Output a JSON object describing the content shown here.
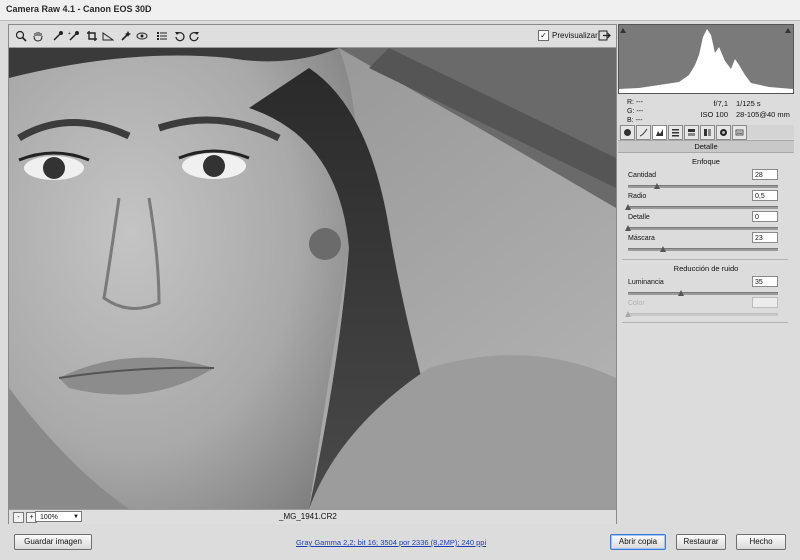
{
  "window": {
    "title": "Camera Raw 4.1 -  Canon EOS 30D"
  },
  "toolbar": {
    "tools": [
      "zoom-icon",
      "hand-icon",
      "white-balance-icon",
      "color-sampler-icon",
      "crop-icon",
      "straighten-icon",
      "retouch-icon",
      "red-eye-icon",
      "preferences-icon",
      "rotate-left-icon",
      "rotate-right-icon"
    ],
    "preview_label": "Previsualizar",
    "preview_checked": "✓"
  },
  "status": {
    "zoom": "100%",
    "filename": "_MG_1941.CR2",
    "zoom_minus": "-",
    "zoom_plus": "+"
  },
  "info": {
    "r_label": "R:",
    "r_value": "---",
    "g_label": "G:",
    "g_value": "---",
    "b_label": "B:",
    "b_value": "---",
    "aperture": "f/7,1",
    "shutter": "1/125 s",
    "iso": "ISO 100",
    "lens": "28-105@40 mm"
  },
  "panel": {
    "title": "Detalle",
    "sharpen_title": "Enfoque",
    "noise_title": "Reducción de ruido",
    "sliders": [
      {
        "label": "Cantidad",
        "value": "28",
        "fraction": 0.19
      },
      {
        "label": "Radio",
        "value": "0,5",
        "fraction": 0.0
      },
      {
        "label": "Detalle",
        "value": "0",
        "fraction": 0.0
      },
      {
        "label": "Máscara",
        "value": "23",
        "fraction": 0.23
      },
      {
        "label": "Luminancia",
        "value": "35",
        "fraction": 0.35
      },
      {
        "label": "Color",
        "value": "",
        "fraction": 0.0
      }
    ]
  },
  "footer": {
    "save_label": "Guardar imagen",
    "workflow_link": "Gray Gamma 2,2; bit 16; 3504 por 2336 (8,2MP); 240 ppi",
    "open_copy_label": "Abrir copia",
    "reset_label": "Restaurar",
    "done_label": "Hecho"
  },
  "colors": {
    "accent": "#3a7bd5",
    "link": "#1a3fb0",
    "histogram_bg": "#7a7a7a",
    "histogram_fill": "#ffffff"
  }
}
